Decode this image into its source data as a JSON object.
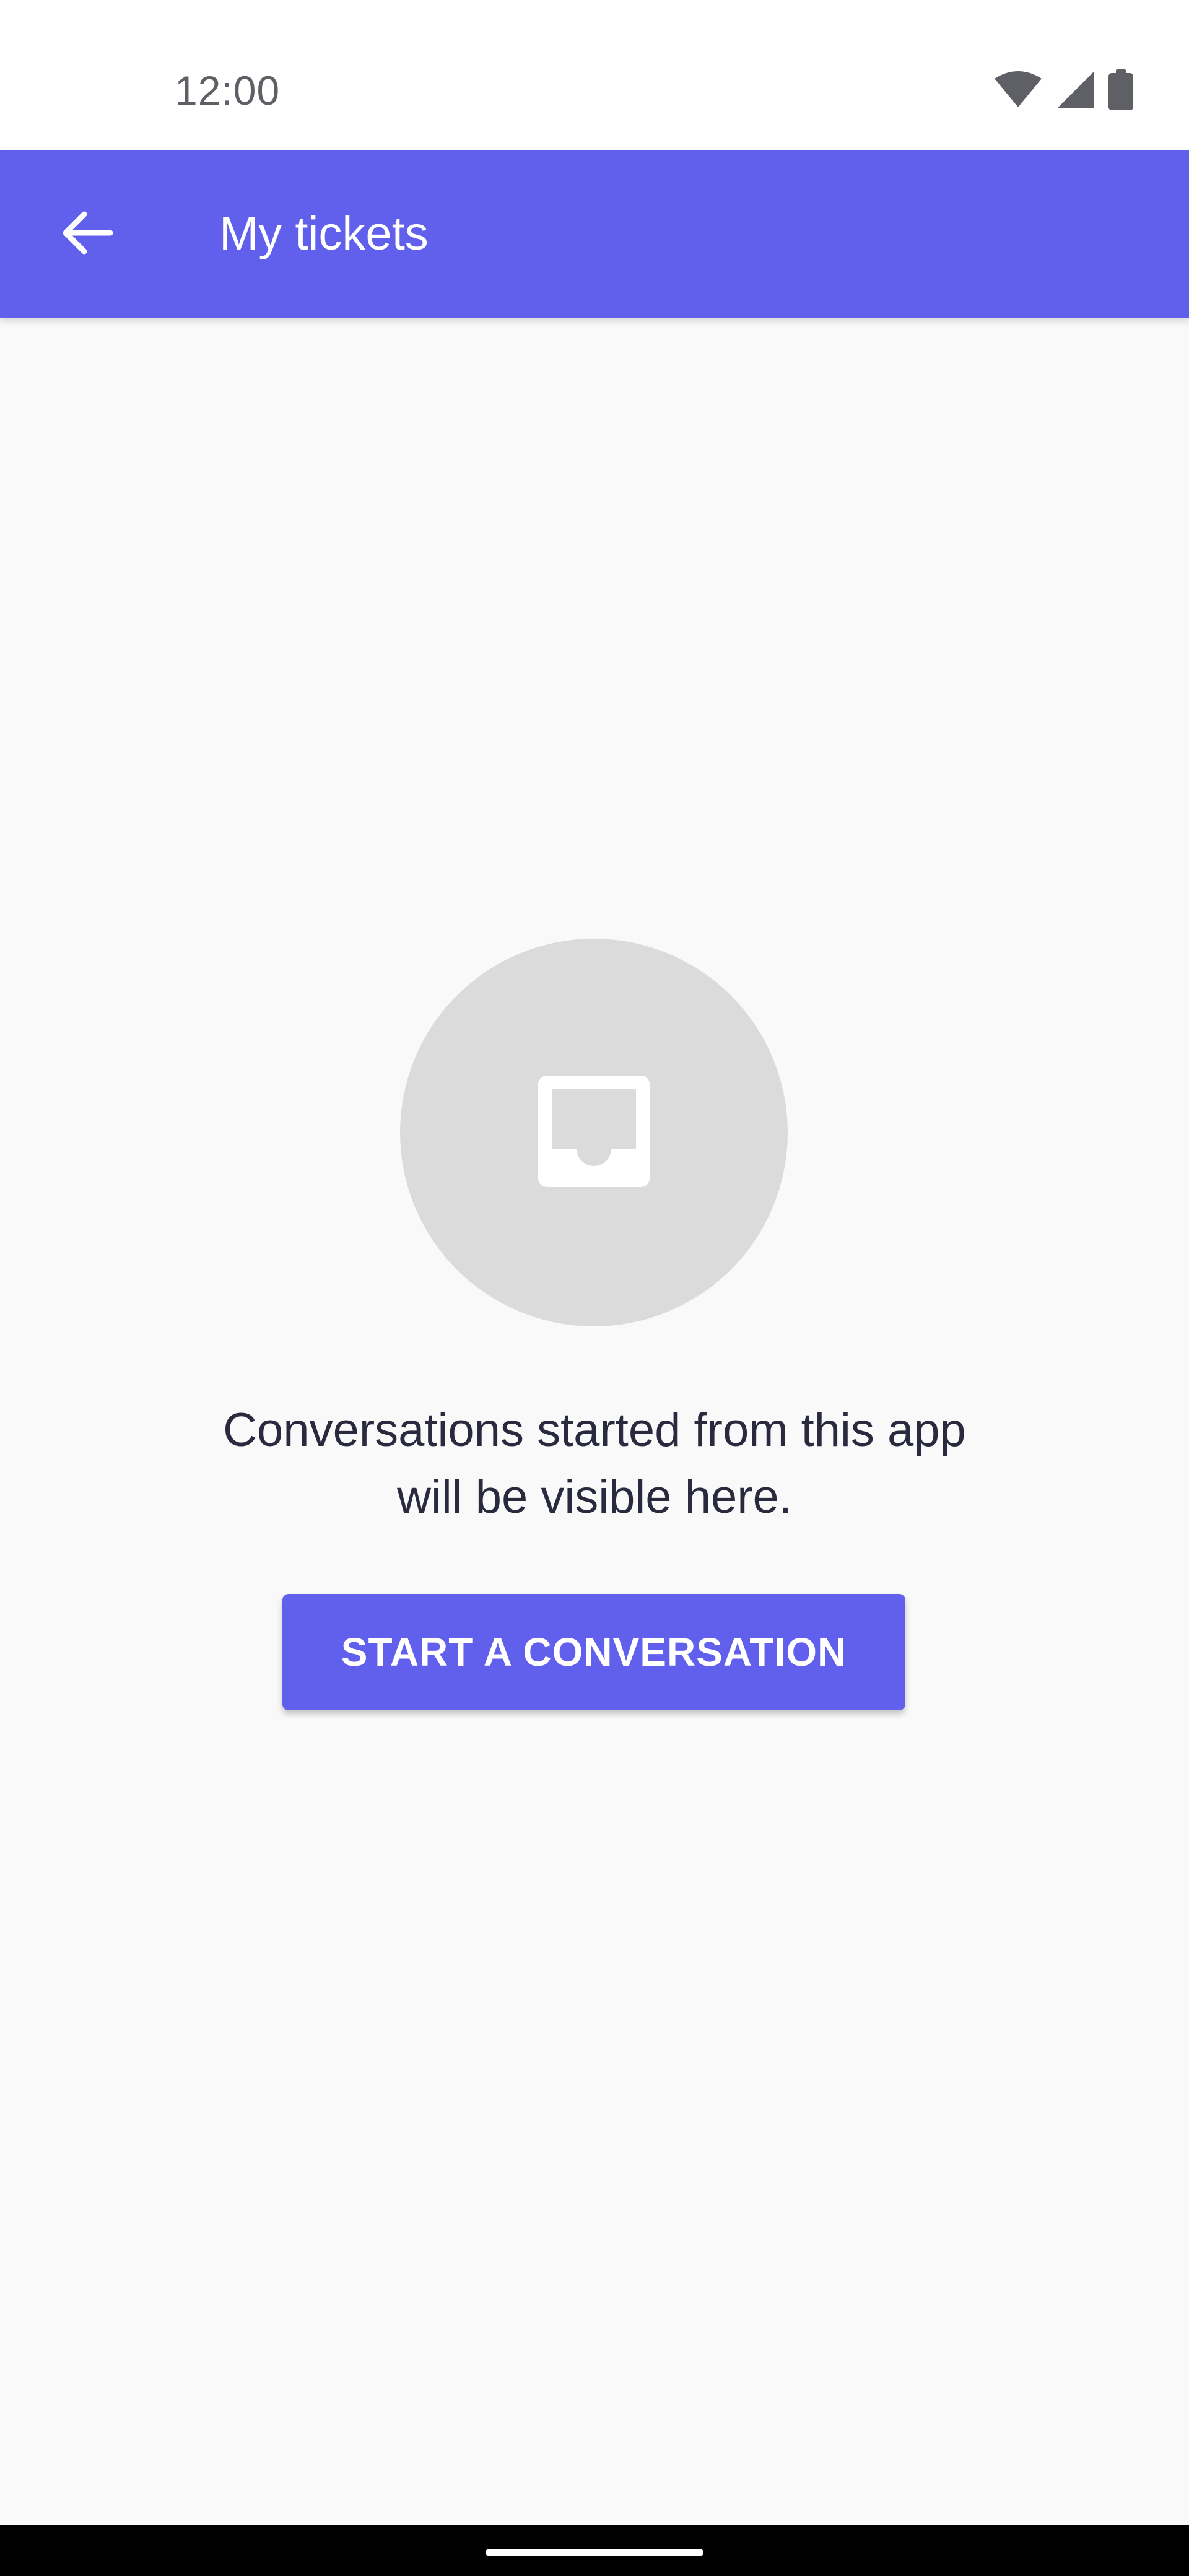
{
  "status_bar": {
    "time": "12:00",
    "icons": [
      "wifi-icon",
      "cellular-signal-icon",
      "battery-icon"
    ]
  },
  "app_bar": {
    "title": "My tickets",
    "back_icon": "arrow-left-icon",
    "background_color": "#6060ec"
  },
  "empty_state": {
    "icon": "inbox-tray-icon",
    "message_line1": "Conversations started from this app",
    "message_line2": "will be visible here.",
    "button_label": "START A CONVERSATION"
  },
  "colors": {
    "accent": "#6060ec",
    "page_background": "#f9f9f9",
    "illustration_circle": "#dbdbdb",
    "text_primary": "#2a2a3e"
  }
}
